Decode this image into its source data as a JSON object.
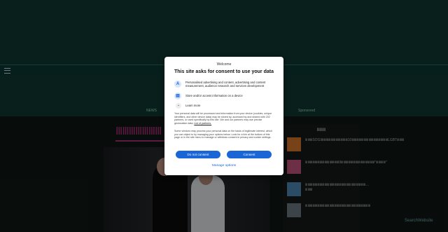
{
  "page": {
    "menu": [
      "NEWS",
      "Sponsored"
    ],
    "headline": "ⅢⅢⅢⅢⅢⅢⅢ",
    "sidebar": {
      "title": "ⅢⅢⅢ",
      "items": [
        {
          "text": "ⅢⅢⅢSOGIⅢⅢⅢⅢⅢⅢⅢⅢⅢⅢⅢ10ⅢⅢⅢⅢⅢⅢⅢⅢⅢⅢⅢⅢⅢⅢⅢLGBTⅢⅢⅢ",
          "thumb_color": "#d9782a"
        },
        {
          "text": "ⅢⅢⅢⅢⅢⅢⅢⅢⅢⅢⅢⅢⅢⅢ9ⅢⅢⅢⅢⅢⅢⅢⅢⅢⅢⅢⅢⅢⅢ\"ⅢⅢⅢⅢ\"",
          "thumb_color": "#c6567f"
        },
        {
          "text": "ⅢⅢⅢⅢⅢⅢⅢⅢⅢⅢⅢⅢⅢⅢⅢⅢⅢⅢⅢⅢⅢⅢⅢⅢⅢ…ⅢⅢⅢ",
          "thumb_color": "#4f8bb6"
        },
        {
          "text": "ⅢⅢⅢⅢⅢⅢⅢⅢⅢⅢⅢⅢⅢⅢⅢⅢⅢⅢⅢⅢⅢⅢⅢⅢⅢⅢⅢ",
          "thumb_color": "#6d7a86"
        }
      ]
    },
    "watermark": "SearchWebsite"
  },
  "consent": {
    "welcome": "Welcome",
    "title": "This site asks for consent to use your data",
    "purposes": [
      {
        "icon": "person-icon",
        "glyph": "A",
        "text": "Personalised advertising and content, advertising and content measurement, audience research and services development"
      },
      {
        "icon": "device-storage-icon",
        "glyph": "▤",
        "text": "Store and/or access information on a device"
      }
    ],
    "learn_more": "Learn more",
    "paragraph1_text": "Your personal data will be processed and information from your device (cookies, unique identifiers, and other device data) may be stored by, accessed by and shared with 202 partners, or used specifically by this site. We and our partners may use precise geolocation data.",
    "paragraph1_link": "List of partners.",
    "paragraph2": "Some vendors may process your personal data on the basis of legitimate interest, which you can object to by managing your options below. Look for a link at the bottom of this page or in the site menu to manage or withdraw consent in privacy and cookie settings.",
    "do_not_consent": "Do not consent",
    "consent": "Consent",
    "manage_options": "Manage options"
  },
  "colors": {
    "accent": "#1a66d6",
    "headline": "#b0327a",
    "header": "#0f3a33"
  }
}
